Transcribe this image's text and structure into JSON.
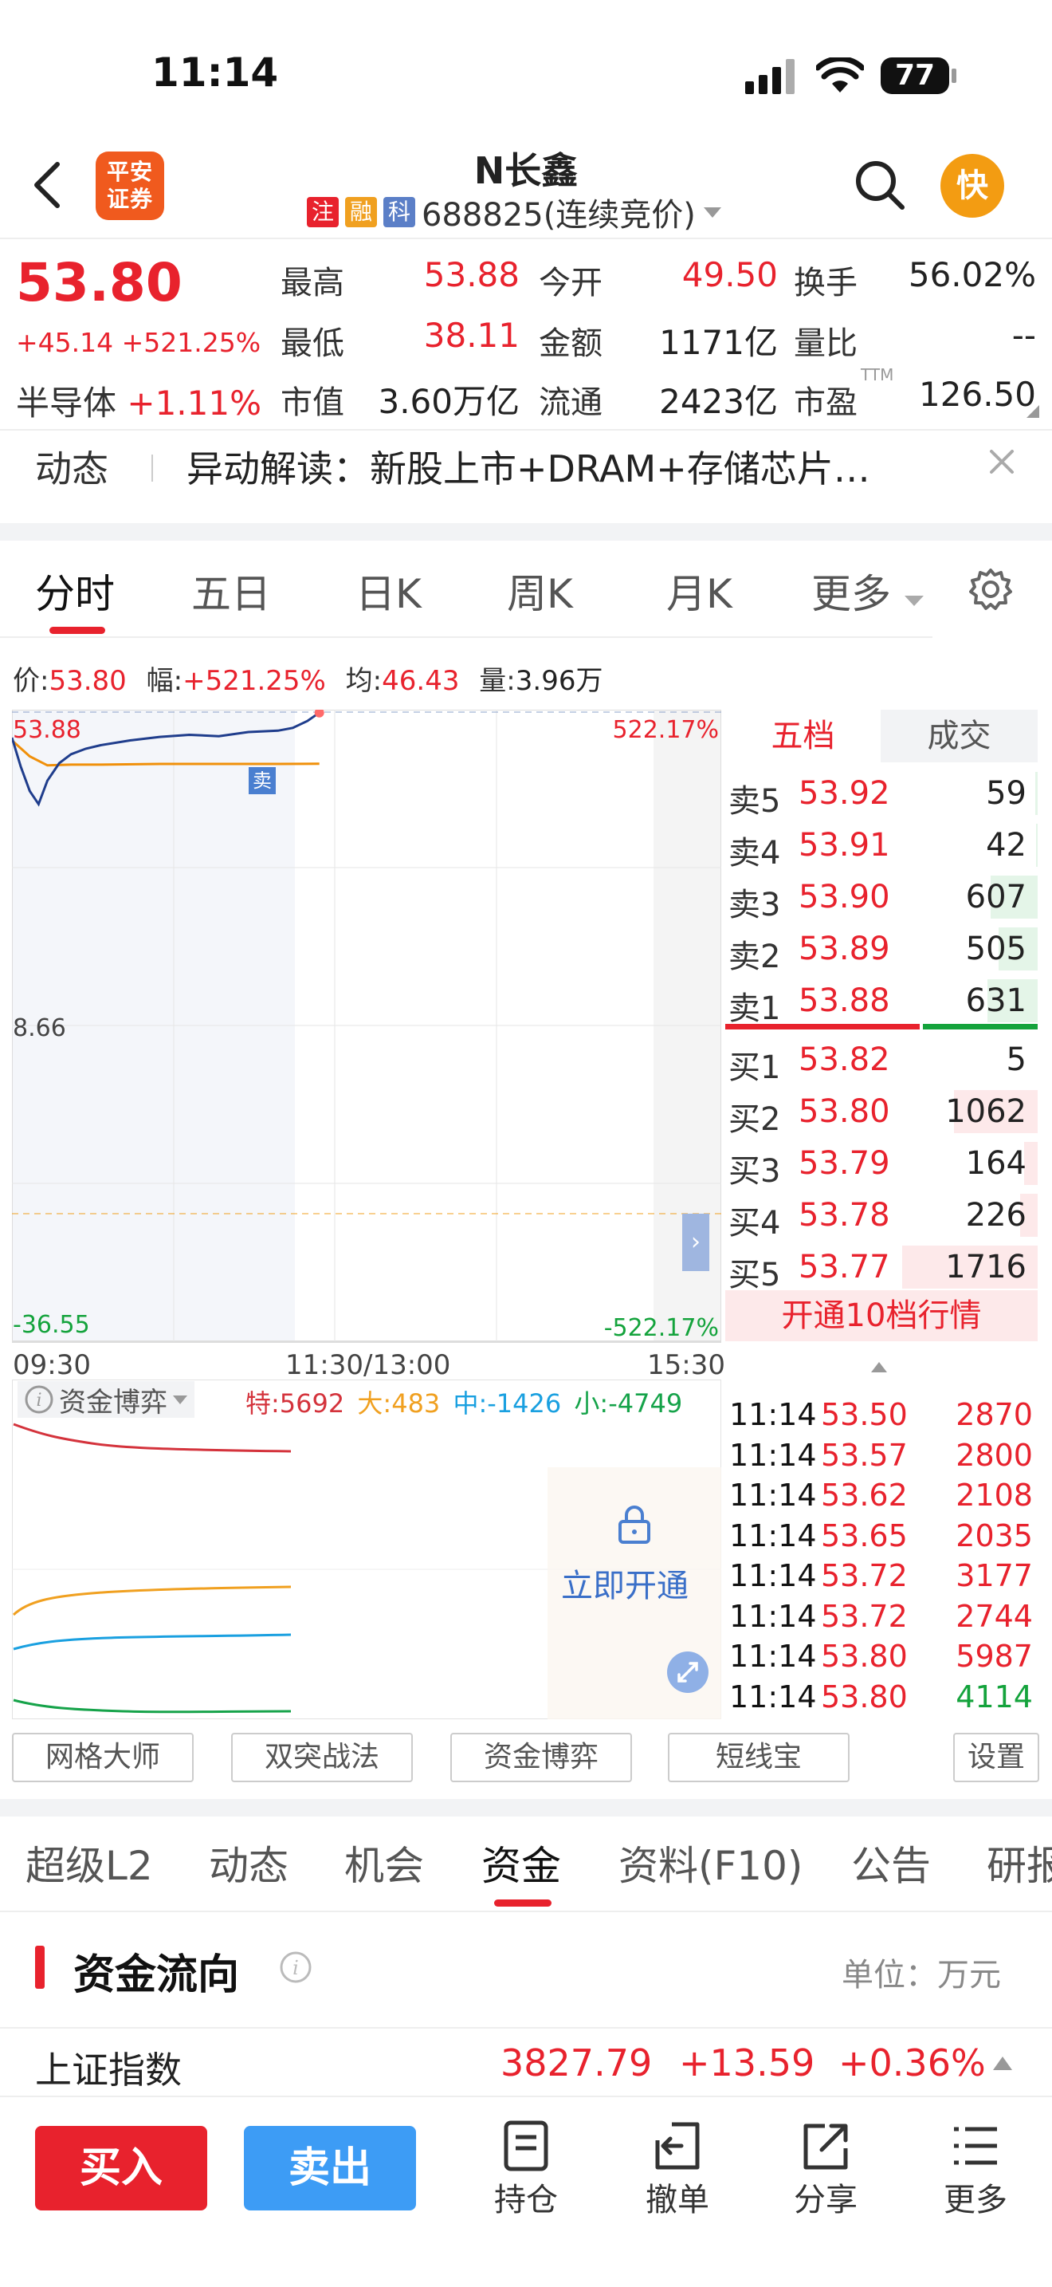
{
  "status": {
    "time": "11:14",
    "battery": "77"
  },
  "header": {
    "stock_name": "N长鑫",
    "tags": [
      "注",
      "融",
      "科"
    ],
    "code": "688825(连续竞价)",
    "broker_logo": "平安证券",
    "quick_label": "快"
  },
  "quote": {
    "price": "53.80",
    "change": "+45.14",
    "change_pct": "+521.25%",
    "sector": "半导体",
    "sector_change": "+1.11%",
    "high_label": "最高",
    "high": "53.88",
    "low_label": "最低",
    "low": "38.11",
    "mktcap_label": "市值",
    "mktcap": "3.60万亿",
    "open_label": "今开",
    "open": "49.50",
    "amount_label": "金额",
    "amount": "1171亿",
    "float_label": "流通",
    "float": "2423亿",
    "turnover_label": "换手",
    "turnover": "56.02%",
    "volratio_label": "量比",
    "volratio": "--",
    "pe_label": "市盈",
    "pe_sup": "TTM",
    "pe": "126.50"
  },
  "news": {
    "tag": "动态",
    "text": "异动解读：新股上市+DRAM+存储芯片…"
  },
  "chart_tabs": [
    "分时",
    "五日",
    "日K",
    "周K",
    "月K",
    "更多"
  ],
  "chart_info": {
    "price_label": "价:",
    "price": "53.80",
    "range_label": "幅:",
    "range": "+521.25%",
    "avg_label": "均:",
    "avg": "46.43",
    "vol_label": "量:",
    "vol": "3.96万"
  },
  "chart_labels": {
    "y_top": "53.88",
    "y_mid": "8.66",
    "y_bot": "-36.55",
    "pct_top": "522.17%",
    "pct_bot": "-522.17%",
    "x_start": "09:30",
    "x_mid": "11:30/13:00",
    "x_end": "15:30",
    "sell_marker": "卖"
  },
  "chart_data": {
    "type": "line",
    "title": "",
    "x_range": [
      "09:30",
      "15:30"
    ],
    "ylim": [
      -36.55,
      53.88
    ],
    "series": [
      {
        "x": [
          "09:30",
          "09:33",
          "09:36",
          "09:39",
          "09:42",
          "09:46",
          "09:50",
          "09:55",
          "10:00",
          "10:10",
          "10:20",
          "10:30",
          "10:40",
          "10:50",
          "11:00",
          "11:05",
          "11:10",
          "11:14"
        ],
        "values": [
          50.2,
          46.0,
          42.5,
          40.6,
          44.0,
          46.5,
          47.8,
          48.6,
          49.1,
          49.8,
          50.3,
          50.6,
          50.4,
          51.0,
          51.2,
          51.6,
          52.6,
          53.8
        ]
      },
      {
        "x": [
          "09:30",
          "09:36",
          "09:42",
          "09:50",
          "10:00",
          "10:20",
          "10:40",
          "11:00",
          "11:14"
        ],
        "values": [
          49.8,
          47.5,
          46.2,
          46.3,
          46.3,
          46.4,
          46.4,
          46.4,
          46.43
        ]
      }
    ]
  },
  "book_tabs": {
    "left": "五档",
    "right": "成交"
  },
  "asks": [
    {
      "label": "卖5",
      "price": "53.92",
      "vol": "59",
      "bar": 0.02
    },
    {
      "label": "卖4",
      "price": "53.91",
      "vol": "42",
      "bar": 0.01
    },
    {
      "label": "卖3",
      "price": "53.90",
      "vol": "607",
      "bar": 0.35
    },
    {
      "label": "卖2",
      "price": "53.89",
      "vol": "505",
      "bar": 0.29
    },
    {
      "label": "卖1",
      "price": "53.88",
      "vol": "631",
      "bar": 0.37
    }
  ],
  "bids": [
    {
      "label": "买1",
      "price": "53.82",
      "vol": "5",
      "bar": 0.0
    },
    {
      "label": "买2",
      "price": "53.80",
      "vol": "1062",
      "bar": 0.62
    },
    {
      "label": "买3",
      "price": "53.79",
      "vol": "164",
      "bar": 0.1
    },
    {
      "label": "买4",
      "price": "53.78",
      "vol": "226",
      "bar": 0.13
    },
    {
      "label": "买5",
      "price": "53.77",
      "vol": "1716",
      "bar": 1.0
    }
  ],
  "level10_label": "开通10档行情",
  "ticks": [
    {
      "time": "11:14",
      "price": "53.50",
      "vol": "2870",
      "dir": "buy"
    },
    {
      "time": "11:14",
      "price": "53.57",
      "vol": "2800",
      "dir": "buy"
    },
    {
      "time": "11:14",
      "price": "53.62",
      "vol": "2108",
      "dir": "buy"
    },
    {
      "time": "11:14",
      "price": "53.65",
      "vol": "2035",
      "dir": "buy"
    },
    {
      "time": "11:14",
      "price": "53.72",
      "vol": "3177",
      "dir": "buy"
    },
    {
      "time": "11:14",
      "price": "53.72",
      "vol": "2744",
      "dir": "buy"
    },
    {
      "time": "11:14",
      "price": "53.80",
      "vol": "5987",
      "dir": "buy"
    },
    {
      "time": "11:14",
      "price": "53.80",
      "vol": "4114",
      "dir": "sell"
    }
  ],
  "fund_game": {
    "label": "资金博弈",
    "te_label": "特:",
    "te": "5692",
    "da_label": "大:",
    "da": "483",
    "zhong_label": "中:",
    "zhong": "-1426",
    "xiao_label": "小:",
    "xiao": "-4749",
    "unlock": "立即开通",
    "colors": {
      "te": "#d4333c",
      "da": "#f0a020",
      "zhong": "#1aa0e0",
      "xiao": "#16a34a"
    }
  },
  "tools": [
    "网格大师",
    "双突战法",
    "资金博弈",
    "短线宝",
    "设置"
  ],
  "nav_tabs": [
    "超级L2",
    "动态",
    "机会",
    "资金",
    "资料(F10)",
    "公告",
    "研报"
  ],
  "fund_flow": {
    "title": "资金流向",
    "unit": "单位：万元"
  },
  "index_row": {
    "name": "上证指数",
    "value": "3827.79",
    "change": "+13.59",
    "pct": "+0.36%"
  },
  "bottom_bar": {
    "buy": "买入",
    "sell": "卖出",
    "holdings": "持仓",
    "cancel": "撤单",
    "share": "分享",
    "more": "更多"
  },
  "icons": [
    "back-arrow-icon",
    "search-icon",
    "settings-gear-icon",
    "close-icon",
    "info-icon",
    "lock-icon",
    "expand-icon",
    "holdings-icon",
    "cancel-order-icon",
    "share-icon",
    "menu-icon"
  ]
}
